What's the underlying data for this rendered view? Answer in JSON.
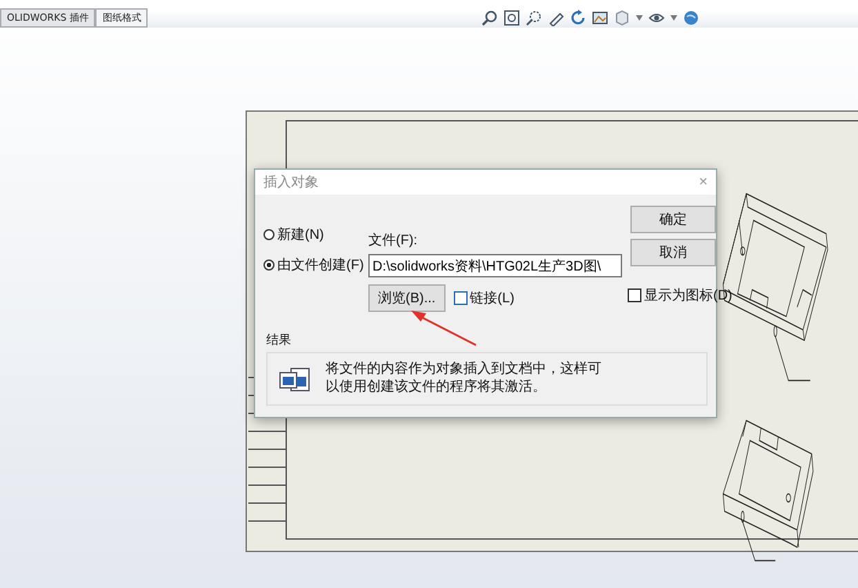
{
  "tabs": [
    {
      "label": "OLIDWORKS 插件",
      "selected": false
    },
    {
      "label": "图纸格式",
      "selected": true
    }
  ],
  "dialog": {
    "title": "插入对象",
    "close": "×",
    "options": [
      {
        "label": "新建(N)",
        "selected": false
      },
      {
        "label": "由文件创建(F)",
        "selected": true
      }
    ],
    "file": {
      "label": "文件(F):",
      "value": "D:\\solidworks资料\\HTG02L生产3D图\\"
    },
    "browse_button": "浏览(B)...",
    "link_checkbox": {
      "label": "链接(L)",
      "checked": false
    },
    "buttons": [
      "确定",
      "取消"
    ],
    "display_as_icon": {
      "label": "显示为图标(D)",
      "checked": false
    },
    "result": {
      "title": "结果",
      "text": "将文件的内容作为对象插入到文档中，这样可以使用创建该文件的程序将其激活。"
    }
  }
}
